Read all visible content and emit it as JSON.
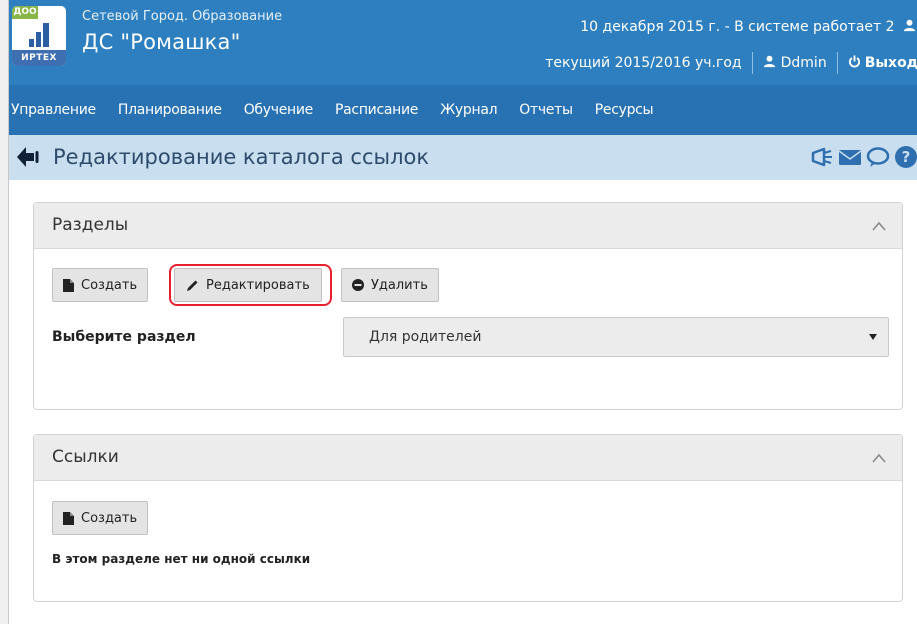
{
  "header": {
    "logo_badge": "ДОО",
    "logo_word": "ИРТЕХ",
    "system_name": "Сетевой Город. Образование",
    "school_name": "ДС \"Ромашка\"",
    "date_status": "10 декабря 2015 г. - В системе работает 2",
    "academic_year": "текущий 2015/2016 уч.год",
    "user_name": "Ddmin",
    "logout_label": "Выход",
    "colors": {
      "header_bg": "#2e7fbf",
      "menu_bg": "#2872b3",
      "titlebar_bg": "#c9dff0",
      "highlight": "#e8202d"
    }
  },
  "menu": {
    "items": [
      "Управление",
      "Планирование",
      "Обучение",
      "Расписание",
      "Журнал",
      "Отчеты",
      "Ресурсы"
    ]
  },
  "titlebar": {
    "back_icon": "arrow-left-icon",
    "title": "Редактирование каталога ссылок",
    "icons": [
      "megaphone-icon",
      "envelope-icon",
      "chat-icon",
      "help-icon"
    ]
  },
  "sections_panel": {
    "title": "Разделы",
    "buttons": {
      "create": "Создать",
      "edit": "Редактировать",
      "delete": "Удалить"
    },
    "select_label": "Выберите раздел",
    "select_value": "Для родителей"
  },
  "links_panel": {
    "title": "Ссылки",
    "create": "Создать",
    "empty_text": "В этом разделе нет ни одной ссылки"
  }
}
